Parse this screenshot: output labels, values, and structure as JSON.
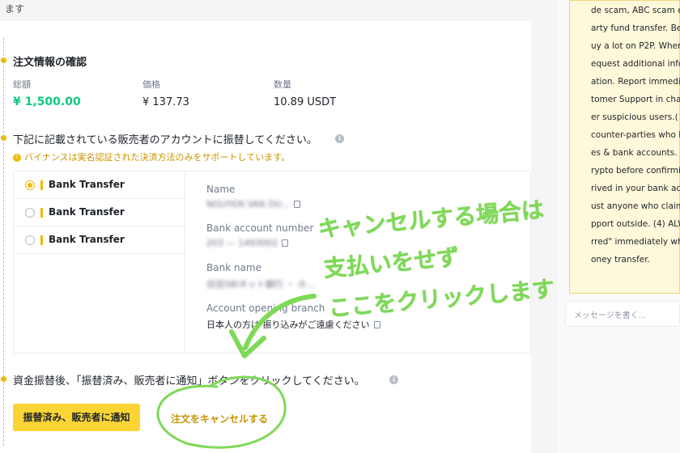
{
  "top": {
    "text": "ます"
  },
  "order_info": {
    "title": "注文情報の確認",
    "total_label": "総額",
    "total_value": "¥ 1,500.00",
    "price_label": "価格",
    "price_value": "¥ 137.73",
    "quantity_label": "数量",
    "quantity_value": "10.89 USDT"
  },
  "transfer": {
    "title": "下記に記載されている販売者のアカウントに振替してください。",
    "warning": "バイナンスは実名認証された決済方法のみをサポートしています。",
    "methods": [
      {
        "label": "Bank Transfer",
        "selected": true
      },
      {
        "label": "Bank Transfer",
        "selected": false
      },
      {
        "label": "Bank Transfer",
        "selected": false
      }
    ],
    "fields": {
      "name_label": "Name",
      "name_value": "NGUYEN VAN DU...",
      "account_label": "Bank account number",
      "account_value": "203 — 1493002",
      "bank_label": "Bank name",
      "bank_value": "住信SBIネット銀行 ・ ホ...",
      "branch_label": "Account opening branch",
      "branch_value": "日本人の方は 振り込みがご遠慮ください"
    }
  },
  "after": {
    "title": "資金振替後、「振替済み、販売者に通知」ボタンをクリックしてください。",
    "confirm_button": "振替済み、販売者に通知",
    "cancel_link": "注文をキャンセルする"
  },
  "chat": {
    "lines": [
      "de scam, ABC scam e",
      "arty fund transfer. Be",
      "uy a lot on P2P. When",
      "equest additional info",
      "ation. Report immedi",
      "tomer Support in cha",
      "er suspicious users.(",
      "counter-parties who l",
      "es & bank accounts. (",
      "rypto before confirmi",
      "rived in your bank acc",
      "ust anyone who claim",
      "pport outside. (4) ALW",
      "rred\" immediately wh",
      "oney transfer."
    ],
    "input_placeholder": "メッセージを書く..."
  },
  "annotation": {
    "line1": "キャンセルする場合は",
    "line2": "支払いをせず",
    "line3": "ここをクリックします"
  },
  "colors": {
    "accent": "#f0b90b",
    "button": "#fcd535",
    "green_value": "#0ecb81",
    "annotation": "#7ed957",
    "warning": "#c99400"
  }
}
